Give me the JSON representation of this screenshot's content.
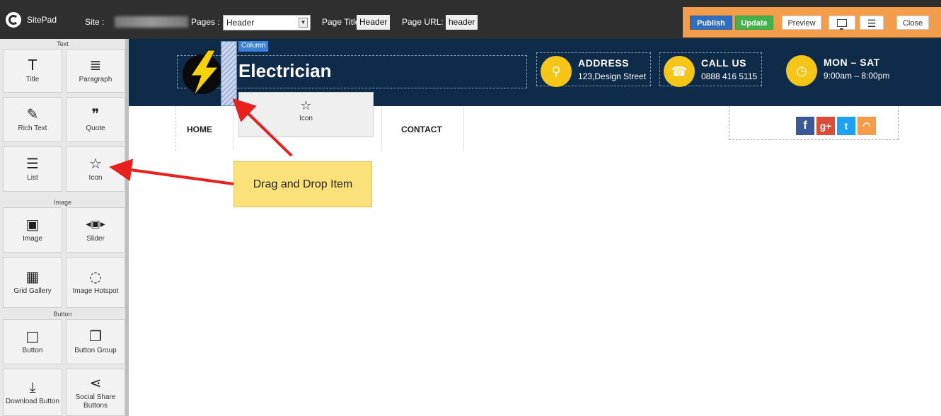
{
  "app": {
    "logo_text": "SitePad",
    "site_label": "Site :",
    "pages_label": "Pages :",
    "pages_selected": "Header",
    "page_title_label": "Page Title:",
    "page_title_value": "Header",
    "page_url_label": "Page URL:",
    "page_url_value": "header"
  },
  "toolbar": {
    "publish_label": "Publish",
    "update_label": "Update",
    "preview_label": "Preview",
    "device_icon": "monitor-icon",
    "menu_icon": "hamburger-menu-icon",
    "close_label": "Close",
    "accent_color": "#f39c4a"
  },
  "sidebar": {
    "sections": [
      "Text",
      "Image",
      "Button"
    ],
    "widgets": [
      {
        "label": "Title",
        "icon": "T"
      },
      {
        "label": "Paragraph",
        "icon": "≣"
      },
      {
        "label": "Rich Text",
        "icon": "✎"
      },
      {
        "label": "Quote",
        "icon": "❞"
      },
      {
        "label": "List",
        "icon": "☰"
      },
      {
        "label": "Icon",
        "icon": "☆"
      },
      {
        "label": "Image",
        "icon": "▣"
      },
      {
        "label": "Slider",
        "icon": "◂▣▸"
      },
      {
        "label": "Grid Gallery",
        "icon": "▦"
      },
      {
        "label": "Image Hotspot",
        "icon": "◌"
      },
      {
        "label": "Button",
        "icon": "□"
      },
      {
        "label": "Button Group",
        "icon": "❐"
      },
      {
        "label": "Download Button",
        "icon": "⤓"
      },
      {
        "label": "Social Share Buttons",
        "icon": "⋖"
      }
    ]
  },
  "canvas": {
    "column_tag": "Column",
    "site_name": "Electrician",
    "info": [
      {
        "title": "ADDRESS",
        "sub": "123,Design Street",
        "icon": "📍"
      },
      {
        "title": "CALL US",
        "sub": "0888 416 5115",
        "icon": "☎"
      },
      {
        "title": "MON – SAT",
        "sub": "9:00am – 8:00pm",
        "icon": "◷"
      }
    ],
    "nav": [
      "HOME",
      "CONTACT"
    ],
    "social": [
      {
        "label": "f",
        "color": "#3b5998"
      },
      {
        "label": "g+",
        "color": "#dd4b39"
      },
      {
        "label": "t",
        "color": "#1da1f2"
      },
      {
        "label": "rss",
        "color": "#f39c4a"
      }
    ],
    "ghost_label": "Icon",
    "ghost_icon": "☆",
    "hero_color": "#0f2b4a",
    "info_circle_color": "#f5c518"
  },
  "callout": {
    "text": "Drag and Drop Item"
  }
}
